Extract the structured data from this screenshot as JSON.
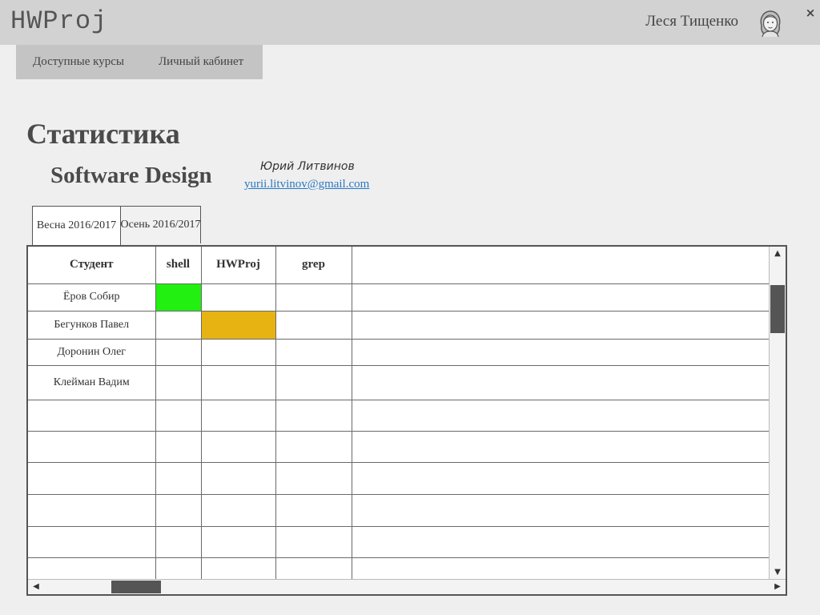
{
  "app": {
    "title": "HWProj"
  },
  "user": {
    "name": "Леся Тищенко",
    "avatar_icon": "user-avatar-icon",
    "close_label": "×"
  },
  "nav": {
    "items": [
      {
        "label": "Доступные курсы"
      },
      {
        "label": "Личный кабинет"
      }
    ]
  },
  "page": {
    "title": "Статистика"
  },
  "course": {
    "name": "Software Design",
    "teacher_name": "Юрий Литвинов",
    "teacher_email": "yurii.litvinov@gmail.com"
  },
  "tabs": [
    {
      "label": "Весна 2016/2017",
      "active": true
    },
    {
      "label": "Осень 2016/2017",
      "active": false
    }
  ],
  "table": {
    "headers": [
      "Студент",
      "shell",
      "HWProj",
      "grep",
      ""
    ],
    "rows": [
      {
        "student": "Ёров Собир",
        "statuses": [
          "done",
          "",
          "",
          ""
        ]
      },
      {
        "student": "Бегунков Павел",
        "statuses": [
          "",
          "partial",
          "",
          ""
        ]
      },
      {
        "student": "Доронин Олег",
        "statuses": [
          "",
          "",
          "",
          ""
        ]
      },
      {
        "student": "Клейман Вадим",
        "statuses": [
          "",
          "",
          "",
          ""
        ]
      },
      {
        "student": "",
        "statuses": [
          "",
          "",
          "",
          ""
        ]
      },
      {
        "student": "",
        "statuses": [
          "",
          "",
          "",
          ""
        ]
      },
      {
        "student": "",
        "statuses": [
          "",
          "",
          "",
          ""
        ]
      },
      {
        "student": "",
        "statuses": [
          "",
          "",
          "",
          ""
        ]
      },
      {
        "student": "",
        "statuses": [
          "",
          "",
          "",
          ""
        ]
      },
      {
        "student": "",
        "statuses": [
          "",
          "",
          "",
          ""
        ]
      }
    ]
  },
  "colors": {
    "done": "#22f010",
    "partial": "#e6b313"
  }
}
